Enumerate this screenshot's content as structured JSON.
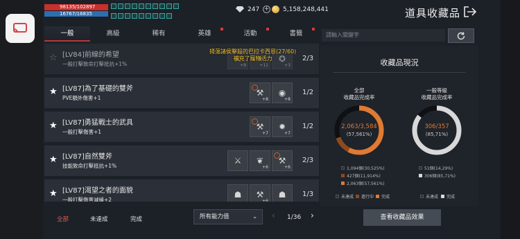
{
  "player": {
    "hp": "98135/102897",
    "mp": "16767/16835"
  },
  "currency": {
    "diamonds": "247",
    "gold": "5,158,248,441"
  },
  "header": {
    "title": "道具收藏品"
  },
  "tabs": [
    {
      "label": "一般",
      "active": true,
      "alert": false
    },
    {
      "label": "高級",
      "active": false,
      "alert": false
    },
    {
      "label": "稀有",
      "active": false,
      "alert": false
    },
    {
      "label": "英雄",
      "active": false,
      "alert": true
    },
    {
      "label": "活動",
      "active": false,
      "alert": true
    },
    {
      "label": "書籤",
      "active": false,
      "alert": true
    }
  ],
  "search": {
    "placeholder": "請輸入關鍵字"
  },
  "collections": [
    {
      "name": "[LV84]前線的希望",
      "effect": "一般打擊致命打擊抵抗+1%",
      "favorite": false,
      "progress": "2/3",
      "items": [
        {
          "icon": "⚔",
          "count": "+9",
          "dim": true
        },
        {
          "icon": "✦",
          "count": "+11",
          "dim": true
        },
        {
          "icon": "✪",
          "count": "+3",
          "dim": true
        }
      ]
    },
    {
      "name": "[LV87]為了基礎的雙斧",
      "effect": "PVE額外傷害+1",
      "favorite": true,
      "progress": "1/2",
      "items": [
        {
          "icon": "⚒",
          "count": "+8",
          "dim": false,
          "check": true
        },
        {
          "icon": "◉",
          "count": "+8",
          "dim": false
        }
      ]
    },
    {
      "name": "[LV87]勇猛戰士的武具",
      "effect": "一般打擊傷害+1",
      "favorite": true,
      "progress": "1/2",
      "items": [
        {
          "icon": "⚒",
          "count": "+7",
          "dim": false,
          "check": true
        },
        {
          "icon": "✹",
          "count": "+7",
          "dim": false
        }
      ]
    },
    {
      "name": "[LV87]自然雙斧",
      "effect": "技能致命打擊抵抗+1%",
      "favorite": true,
      "progress": "2/3",
      "items": [
        {
          "icon": "⚔",
          "count": "",
          "dim": false
        },
        {
          "icon": "❦",
          "count": "+6",
          "dim": false
        },
        {
          "icon": "⚒",
          "count": "+6",
          "dim": false,
          "check": true
        }
      ]
    },
    {
      "name": "[LV87]渴望之者的面貌",
      "effect": "一般打擊傷害減緩+2",
      "favorite": true,
      "progress": "1/3",
      "items": [
        {
          "icon": "☗",
          "count": "",
          "dim": false
        },
        {
          "icon": "⚒",
          "count": "+6",
          "dim": false
        },
        {
          "icon": "☗",
          "count": "",
          "dim": false
        }
      ]
    }
  ],
  "notification": {
    "line1": "掃蕩諸侯擊殺的巴拉卡西恩(27/60)",
    "line2": "補充了寵物活力"
  },
  "filters": {
    "all": "全部",
    "incomplete": "未達成",
    "complete": "完成"
  },
  "ability_filter": {
    "selected": "所有能力值"
  },
  "pagination": {
    "text": "1/36"
  },
  "status_panel": {
    "title": "收藏品現況",
    "all": {
      "label1": "全部",
      "label2": "收藏品完成率",
      "value": "2,063/3,584",
      "percent": "(57,561%)",
      "completion": 0.5756,
      "inprogress_share": 0.1191,
      "legend": [
        {
          "text": "1,094個(30,525%)",
          "color": "#2a2e35"
        },
        {
          "text": "427個(11,914%)",
          "color": "#8c4a1e"
        },
        {
          "text": "2,063個(57,561%)",
          "color": "#e07a33"
        }
      ],
      "keys": [
        {
          "text": "未達成",
          "color": "#2a2e35"
        },
        {
          "text": "進行中",
          "color": "#8c4a1e"
        },
        {
          "text": "完成",
          "color": "#e07a33"
        }
      ]
    },
    "normal": {
      "label1": "一般等級",
      "label2": "收藏品完成率",
      "value": "306/357",
      "percent": "(85,71%)",
      "completion": 0.8571,
      "legend": [
        {
          "text": "51個(14,29%)",
          "color": "#2a2e35"
        },
        {
          "text": "306個(85,71%)",
          "color": "#d8d8d8"
        }
      ],
      "keys": [
        {
          "text": "未達成",
          "color": "#2a2e35"
        },
        {
          "text": "完成",
          "color": "#d8d8d8"
        }
      ]
    }
  },
  "effect_button": {
    "label": "查看收藏品效果"
  }
}
